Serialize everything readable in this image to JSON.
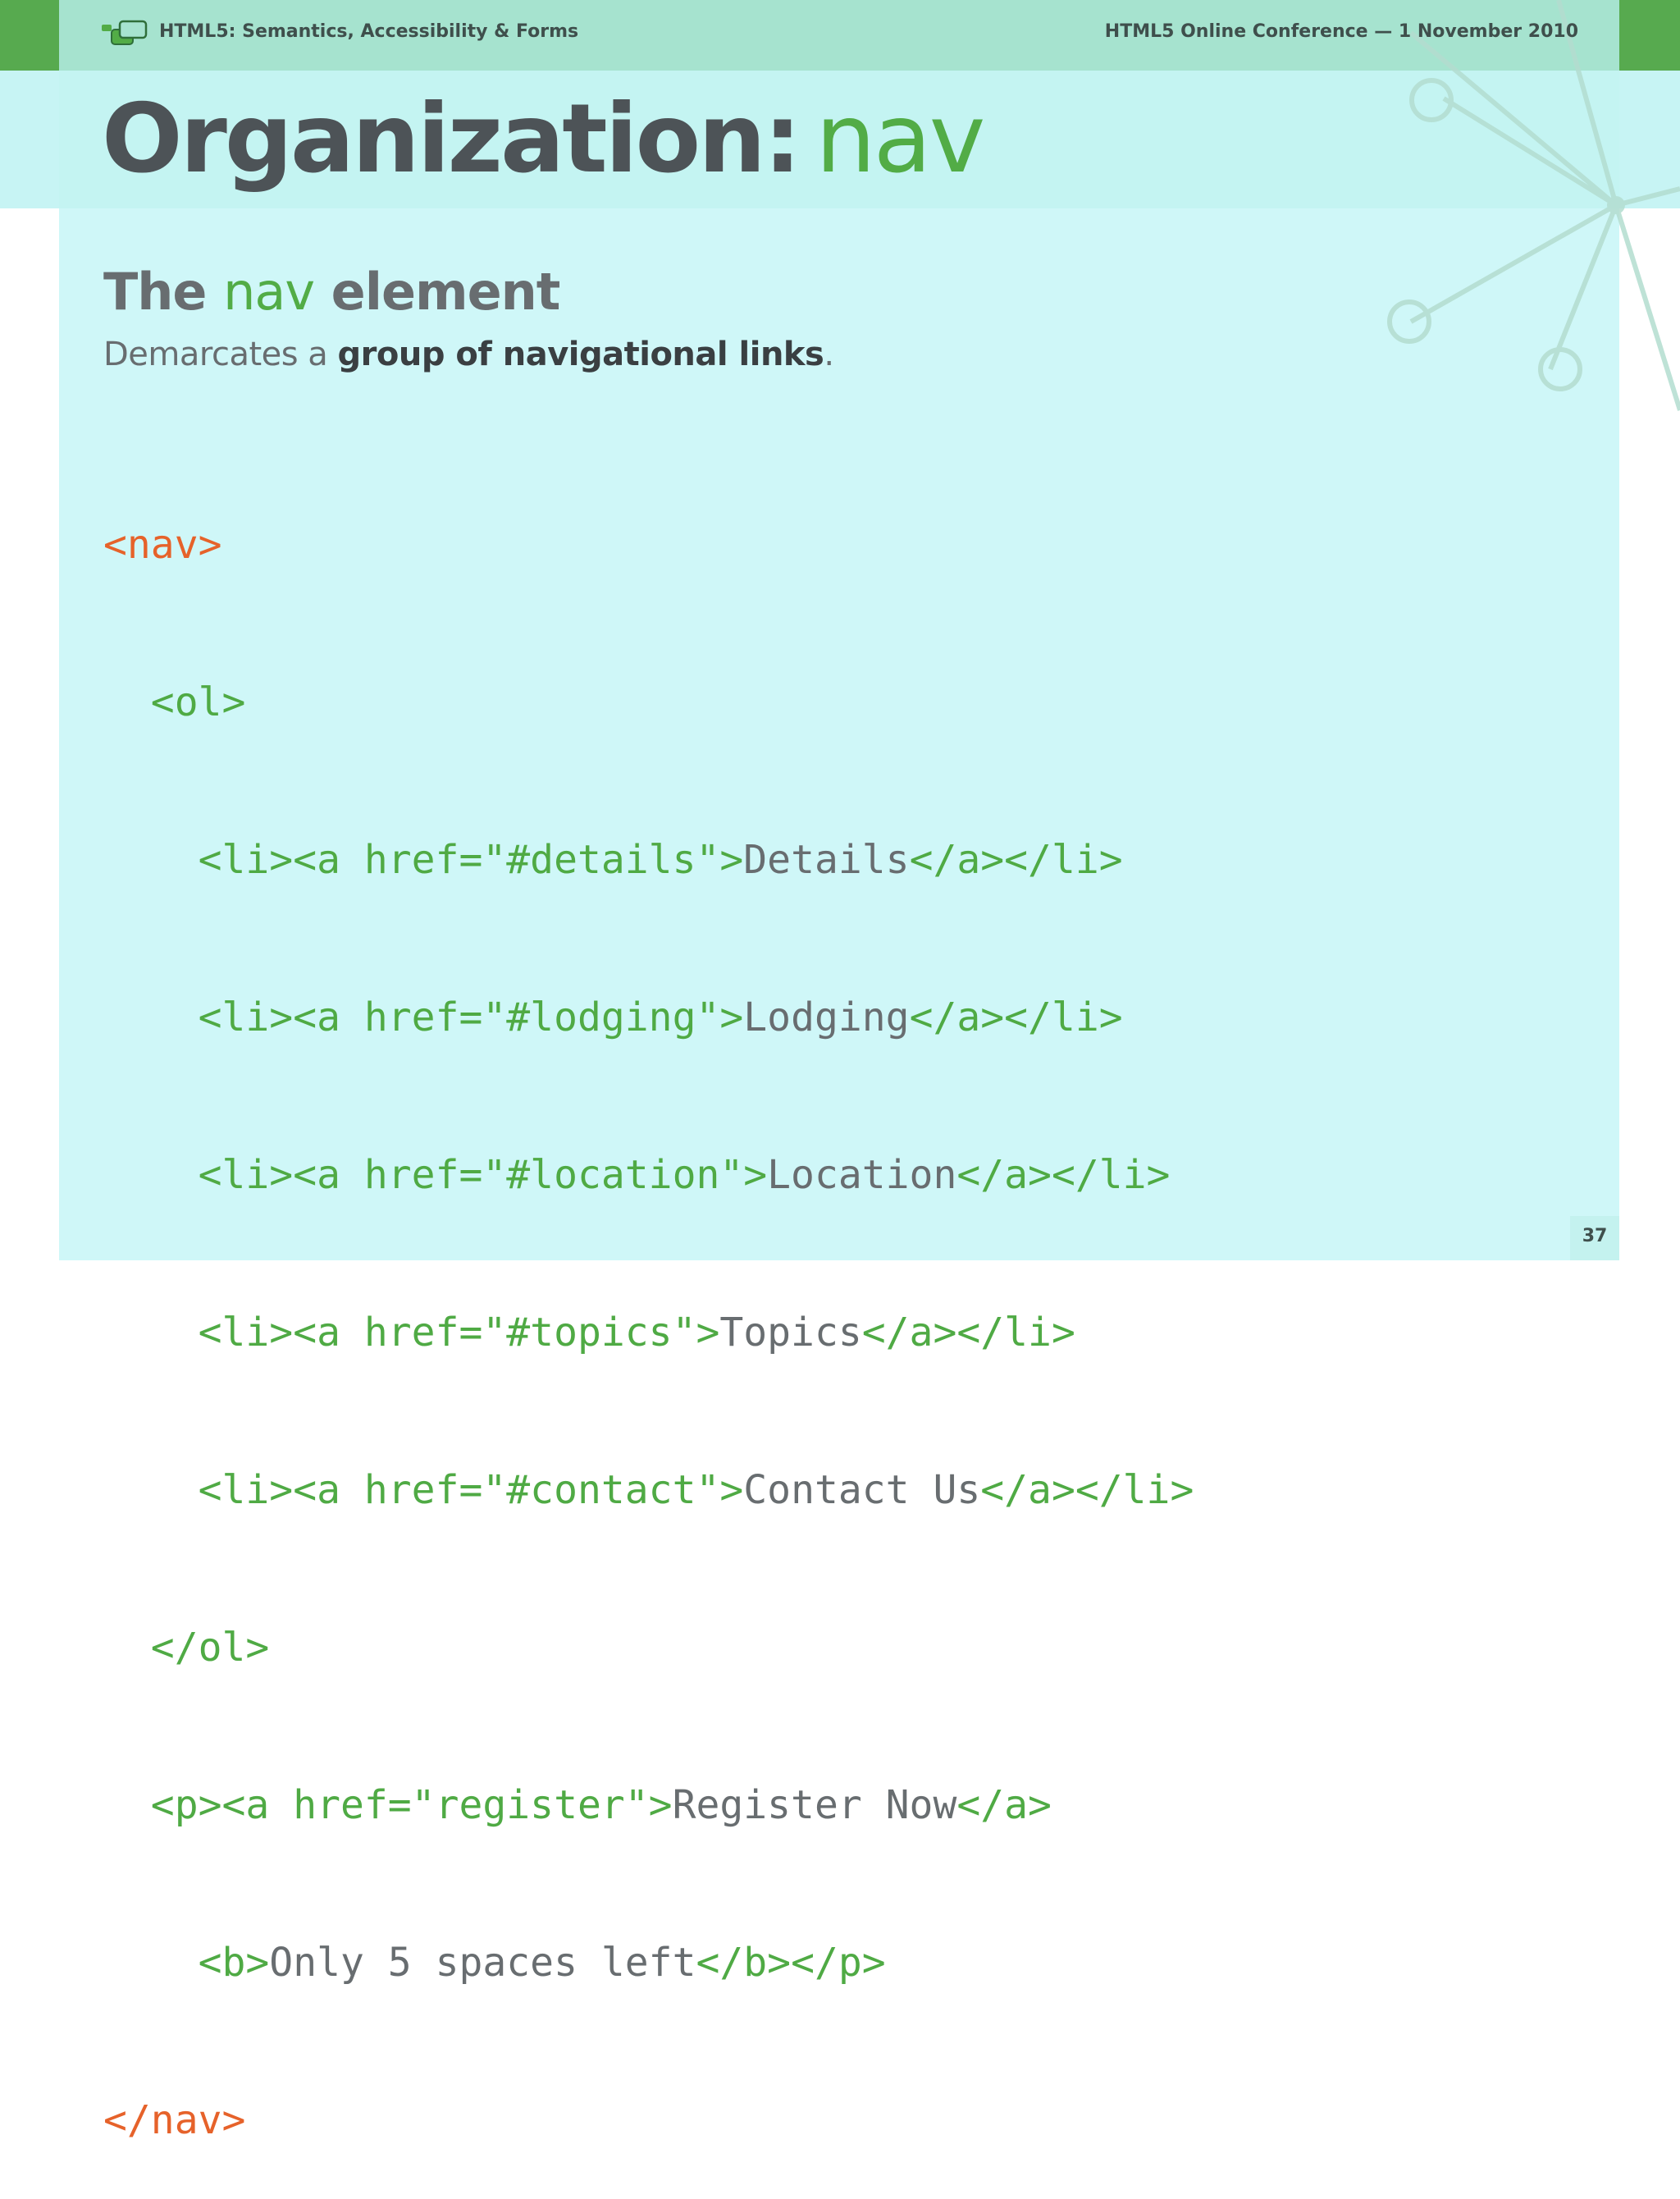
{
  "header": {
    "deck_title": "HTML5: Semantics, Accessibility & Forms",
    "event": "HTML5 Online Conference — 1 November 2010"
  },
  "slide": {
    "title_main": "Organization:",
    "title_accent": "nav",
    "subtitle_pre": "The",
    "subtitle_accent": "nav",
    "subtitle_post": "element",
    "description_pre": "Demarcates a",
    "description_strong": "group of navigational links",
    "description_post": "."
  },
  "code": {
    "nav_open": "<nav>",
    "ol_open": "  <ol>",
    "items": [
      {
        "indent": "    ",
        "open": "<li><a href=\"#details\">",
        "text": "Details",
        "close": "</a></li>"
      },
      {
        "indent": "    ",
        "open": "<li><a href=\"#lodging\">",
        "text": "Lodging",
        "close": "</a></li>"
      },
      {
        "indent": "    ",
        "open": "<li><a href=\"#location\">",
        "text": "Location",
        "close": "</a></li>"
      },
      {
        "indent": "    ",
        "open": "<li><a href=\"#topics\">",
        "text": "Topics",
        "close": "</a></li>"
      },
      {
        "indent": "    ",
        "open": "<li><a href=\"#contact\">",
        "text": "Contact Us",
        "close": "</a></li>"
      }
    ],
    "ol_close": "  </ol>",
    "p_open": "  <p><a href=\"register\">",
    "p_text": "Register Now",
    "p_a_close": "</a>",
    "b_indent": "    ",
    "b_open": "<b>",
    "b_text": "Only 5 spaces left",
    "b_close": "</b></p>",
    "nav_close": "</nav>"
  },
  "footer": {
    "page_number": "37"
  },
  "colors": {
    "accent_green": "#52ac46",
    "nav_orange": "#e6622a",
    "header_bg": "#a6e3cf",
    "panel_bg": "#cff7f8",
    "text_gray": "#686d70"
  },
  "icons": {
    "logo": "chat-bubbles-icon",
    "decoration": "network-nodes-decoration"
  }
}
